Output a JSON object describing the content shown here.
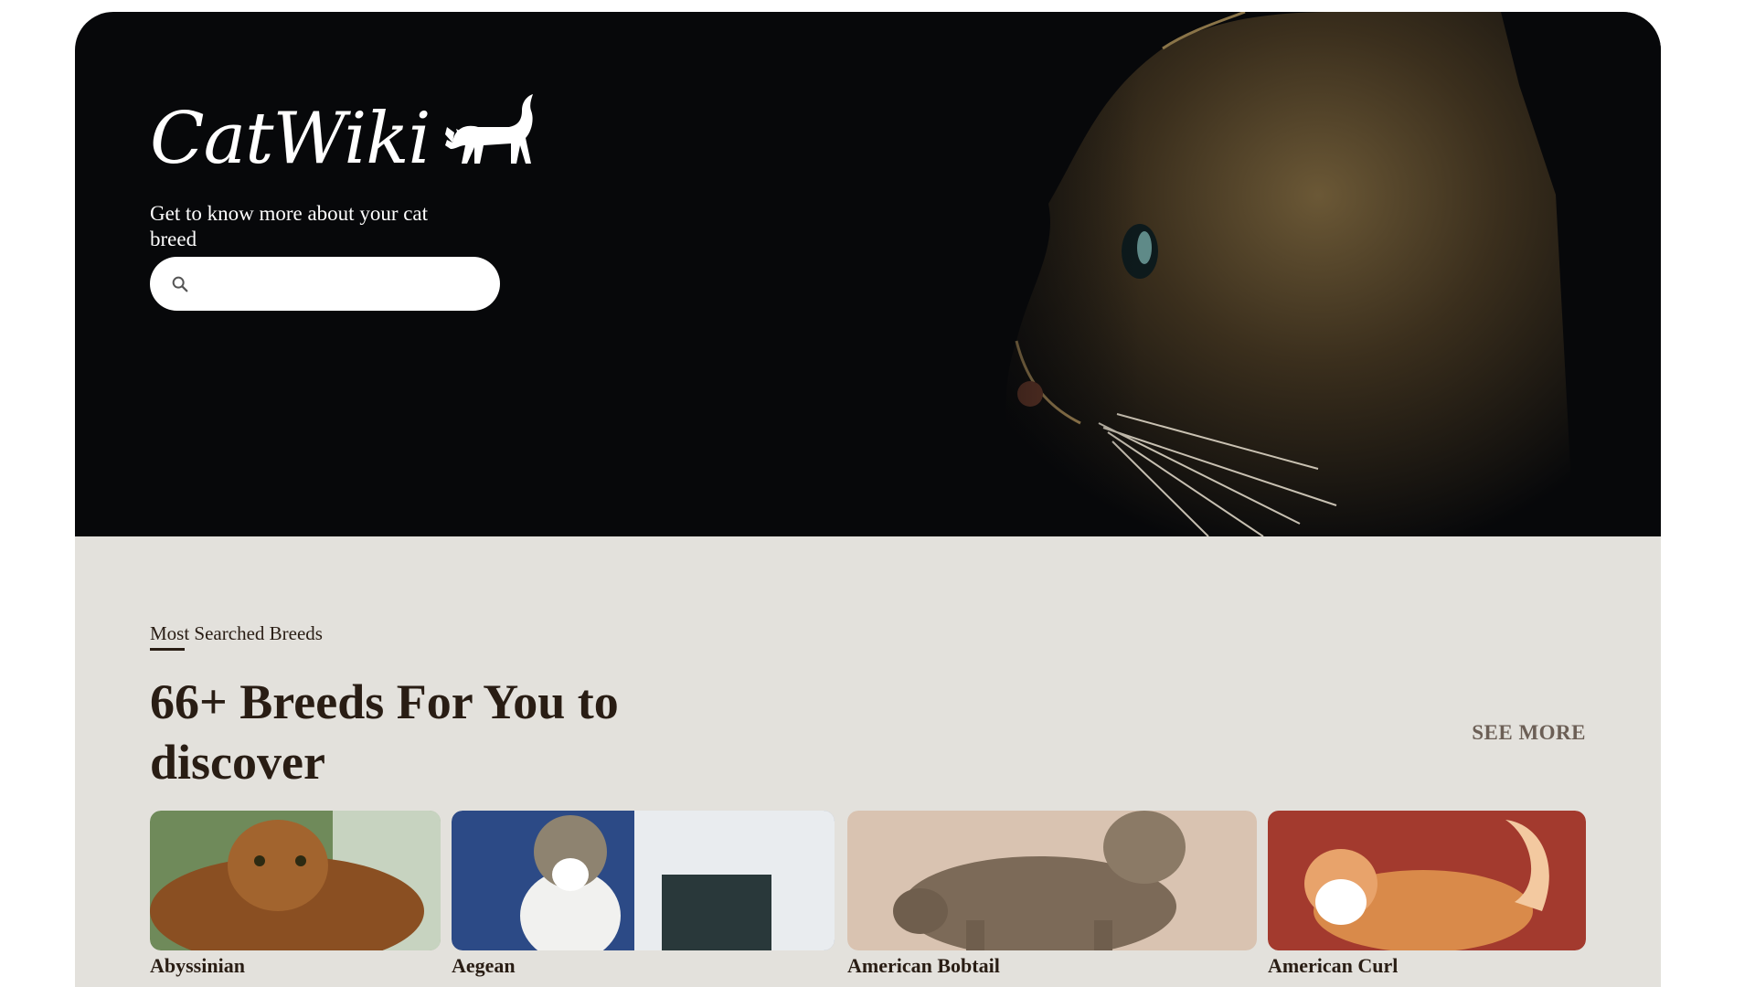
{
  "brand": {
    "name": "CatWiki",
    "logo_icon": "cat-silhouette-icon"
  },
  "hero": {
    "tagline": "Get to know more about your cat breed",
    "search": {
      "placeholder": "",
      "value": "",
      "icon": "search-icon"
    },
    "image": "cat-profile-portrait"
  },
  "breeds_section": {
    "label": "Most Searched Breeds",
    "heading": "66+ Breeds For You to discover",
    "see_more": "SEE MORE",
    "cards": [
      {
        "name": "Abyssinian"
      },
      {
        "name": "Aegean"
      },
      {
        "name": "American Bobtail"
      },
      {
        "name": "American Curl"
      }
    ]
  },
  "colors": {
    "hero_bg": "#07080a",
    "section_bg": "#e3e1dc",
    "heading": "#291d14",
    "see_more": "#6c5f56"
  }
}
